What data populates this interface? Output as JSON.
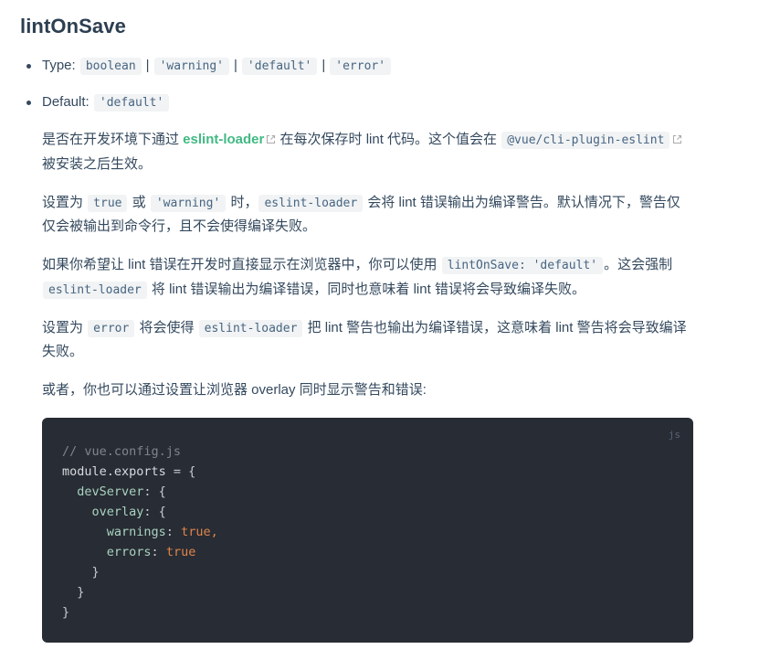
{
  "page": {
    "title": "lintOnSave"
  },
  "meta_list": [
    {
      "label": "Type:",
      "values": [
        "boolean",
        "'warning'",
        "'default'",
        "'error'"
      ],
      "separator": "|"
    },
    {
      "label": "Default:",
      "values": [
        "'default'"
      ]
    }
  ],
  "paragraphs": {
    "p1": {
      "t1": "是否在开发环境下通过 ",
      "link": "eslint-loader",
      "t2": " 在每次保存时 lint 代码。这个值会在 ",
      "code1": "@vue/cli-plugin-eslint",
      "t3": " 被安装之后生效。"
    },
    "p2": {
      "t1": "设置为 ",
      "code1": "true",
      "t2": " 或 ",
      "code2": "'warning'",
      "t3": " 时，",
      "code3": "eslint-loader",
      "t4": " 会将 lint 错误输出为编译警告。默认情况下，警告仅仅会被输出到命令行，且不会使得编译失败。"
    },
    "p3": {
      "t1": "如果你希望让 lint 错误在开发时直接显示在浏览器中，你可以使用 ",
      "code1": "lintOnSave: 'default'",
      "t2": "。这会强制 ",
      "code2": "eslint-loader",
      "t3": " 将 lint 错误输出为编译错误，同时也意味着 lint 错误将会导致编译失败。"
    },
    "p4": {
      "t1": "设置为 ",
      "code1": "error",
      "t2": " 将会使得 ",
      "code2": "eslint-loader",
      "t3": " 把 lint 警告也输出为编译错误，这意味着 lint 警告将会导致编译失败。"
    },
    "p5": {
      "t1": "或者，你也可以通过设置让浏览器 overlay 同时显示警告和错误:"
    }
  },
  "code_block": {
    "language_label": "js",
    "lines": {
      "l1": "// vue.config.js",
      "l2_a": "module.exports",
      "l2_b": " = {",
      "l3_a": "  devServer",
      "l3_b": ": {",
      "l4_a": "    overlay",
      "l4_b": ": {",
      "l5_a": "      warnings",
      "l5_b": ": ",
      "l5_c": "true",
      "l5_d": ",",
      "l6_a": "      errors",
      "l6_b": ": ",
      "l6_c": "true",
      "l7": "    }",
      "l8": "  }",
      "l9": "}"
    }
  },
  "colors": {
    "accent_green": "#42b983",
    "inline_code_bg": "#f1f3f4",
    "inline_code_fg": "#476582",
    "code_block_bg": "#282c34",
    "text": "#34495e",
    "bool_orange": "#e0854a"
  }
}
